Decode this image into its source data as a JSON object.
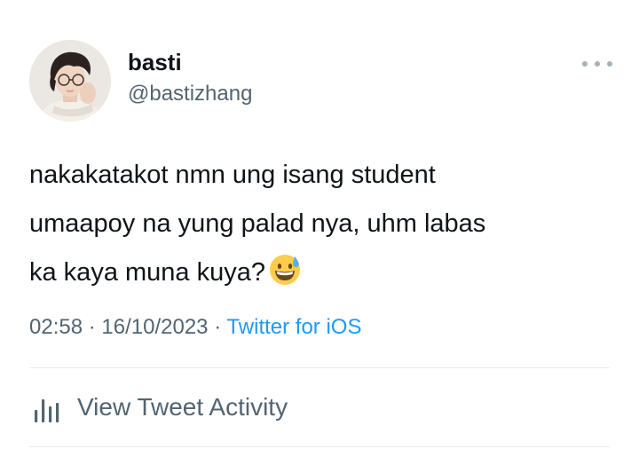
{
  "author": {
    "display_name": "basti",
    "handle": "@bastizhang"
  },
  "tweet": {
    "text": "nakakatakot nmn ung isang student\numaapoy na yung palad nya, uhm labas\nka kaya muna kuya?",
    "emoji": "grinning-face-with-sweat",
    "time": "02:58",
    "separator": "·",
    "date": "16/10/2023",
    "source": "Twitter for iOS"
  },
  "activity": {
    "label": "View Tweet Activity",
    "icon": "bar-chart-icon"
  },
  "colors": {
    "text": "#0f1419",
    "secondary": "#536471",
    "link": "#1d9bf0",
    "divider": "#e7ebee"
  }
}
